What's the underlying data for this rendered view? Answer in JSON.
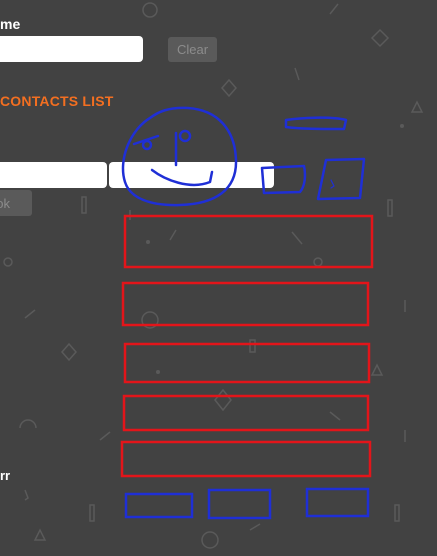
{
  "name_field": {
    "label": "me",
    "value": "",
    "placeholder": ""
  },
  "clear_button": {
    "label": "Clear"
  },
  "contacts_heading": "CONTACTS LIST",
  "contact_form": {
    "left_input_value": "",
    "right_input_value": "",
    "ok_button_label": "ok"
  },
  "bottom_label": "rr",
  "colors": {
    "background": "#424242",
    "accent": "#f36f21",
    "sketch_blue": "#1f2fd6",
    "sketch_red": "#e3151a"
  }
}
